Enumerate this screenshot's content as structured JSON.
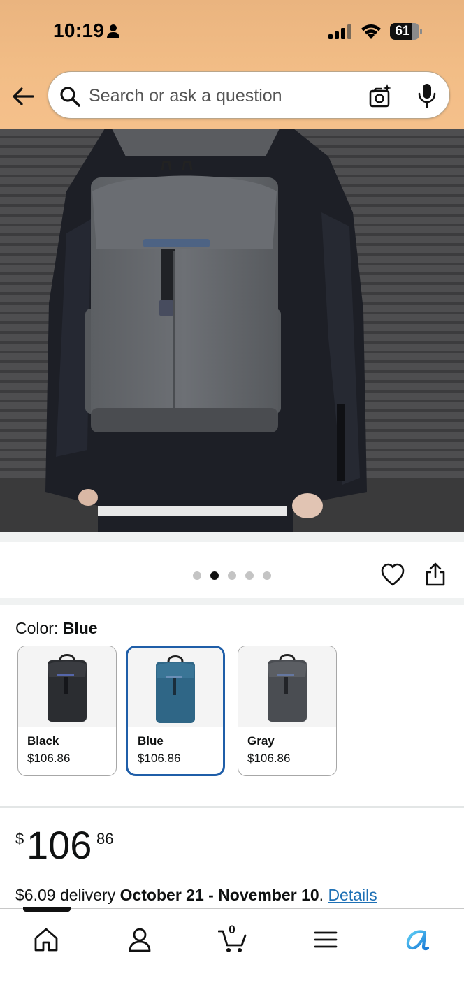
{
  "status_bar": {
    "time": "10:19",
    "battery": "61",
    "icons": [
      "person-icon",
      "signal-icon",
      "wifi-icon",
      "battery-icon"
    ]
  },
  "header": {
    "back_icon": "back-arrow-icon",
    "search_placeholder": "Search or ask a question",
    "camera_icon": "camera-search-icon",
    "mic_icon": "microphone-icon"
  },
  "gallery": {
    "image_count": 5,
    "active_index": 1,
    "actions": [
      "heart-icon",
      "share-icon"
    ]
  },
  "color": {
    "label": "Color: ",
    "selected": "Blue",
    "options": [
      {
        "name": "Black",
        "price": "$106.86",
        "selected": false,
        "color": "#2b2d31"
      },
      {
        "name": "Blue",
        "price": "$106.86",
        "selected": true,
        "color": "#2f6686"
      },
      {
        "name": "Gray",
        "price": "$106.86",
        "selected": false,
        "color": "#4a4d52"
      }
    ]
  },
  "price": {
    "symbol": "$",
    "whole": "106",
    "fraction": "86"
  },
  "delivery": {
    "prefix": "$6.09 delivery ",
    "dates": "October 21 - November 10",
    "suffix": ". ",
    "link": "Details"
  },
  "bottom_nav": {
    "cart_count": "0",
    "items": [
      "home-icon",
      "account-icon",
      "cart-icon",
      "menu-icon",
      "rufus-icon"
    ]
  },
  "colors": {
    "header_bg": "#f2bd86",
    "link": "#1e70b5",
    "selected_border": "#1f5ea8",
    "rufus_accent": "#1aa7e8"
  }
}
